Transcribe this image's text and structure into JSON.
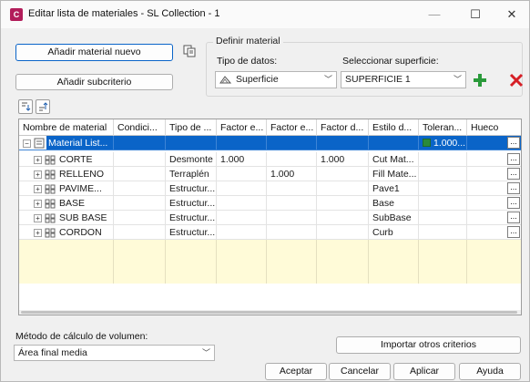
{
  "window": {
    "title": "Editar lista de materiales - SL Collection - 1",
    "app_icon_letter": "C",
    "controls": {
      "minimize": "—",
      "maximize": "☐",
      "close": "✕"
    }
  },
  "left_buttons": {
    "add_material": "Añadir material nuevo",
    "add_subcriteria": "Añadir subcriterio"
  },
  "define_material": {
    "group_label": "Definir material",
    "data_type_label": "Tipo de datos:",
    "data_type_value": "Superficie",
    "surface_label": "Seleccionar superficie:",
    "surface_value": "SUPERFICIE 1"
  },
  "table": {
    "columns": [
      "Nombre de material",
      "Condici...",
      "Tipo de ...",
      "Factor e...",
      "Factor e...",
      "Factor d...",
      "Estilo d...",
      "Toleran...",
      "Hueco"
    ],
    "rows": [
      {
        "name": "Material List...",
        "cond": "",
        "type": "",
        "f1": "",
        "f2": "",
        "f3": "",
        "style": "",
        "tol": "1.000...",
        "selected": true
      },
      {
        "name": "CORTE",
        "cond": "",
        "type": "Desmonte",
        "f1": "1.000",
        "f2": "",
        "f3": "1.000",
        "style": "Cut Mat...",
        "tol": "",
        "selected": false
      },
      {
        "name": "RELLENO",
        "cond": "",
        "type": "Terraplén",
        "f1": "",
        "f2": "1.000",
        "f3": "",
        "style": "Fill Mate...",
        "tol": "",
        "selected": false
      },
      {
        "name": "PAVIME...",
        "cond": "",
        "type": "Estructur...",
        "f1": "",
        "f2": "",
        "f3": "",
        "style": "Pave1",
        "tol": "",
        "selected": false
      },
      {
        "name": "BASE",
        "cond": "",
        "type": "Estructur...",
        "f1": "",
        "f2": "",
        "f3": "",
        "style": "Base",
        "tol": "",
        "selected": false
      },
      {
        "name": "SUB BASE",
        "cond": "",
        "type": "Estructur...",
        "f1": "",
        "f2": "",
        "f3": "",
        "style": "SubBase",
        "tol": "",
        "selected": false
      },
      {
        "name": "CORDON",
        "cond": "",
        "type": "Estructur...",
        "f1": "",
        "f2": "",
        "f3": "",
        "style": "Curb",
        "tol": "",
        "selected": false
      }
    ],
    "ellipsis": "..."
  },
  "volume": {
    "label": "Método de cálculo de volumen:",
    "value": "Área final media"
  },
  "footer": {
    "import": "Importar otros criterios",
    "accept": "Aceptar",
    "cancel": "Cancelar",
    "apply": "Aplicar",
    "help": "Ayuda"
  },
  "colors": {
    "selection": "#0a64c8",
    "add_green": "#2a9a3a",
    "delete_red": "#d61f26",
    "empty_yellow": "#fffbd8"
  }
}
